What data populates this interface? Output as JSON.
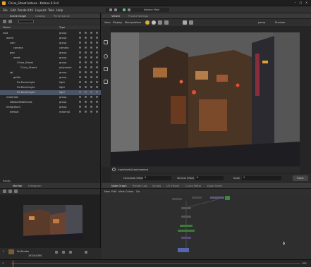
{
  "window": {
    "title": "China_Street.katana - Katana 6.5v4"
  },
  "menubar": {
    "items": [
      "File",
      "Edit",
      "Render",
      "Util",
      "Layouts",
      "Tabs",
      "Help"
    ],
    "layout": "Katana Main"
  },
  "scenegraph": {
    "tabs": [
      "Scene Graph",
      "Catalog",
      "Performance"
    ],
    "columns": [
      "Name",
      "Type"
    ],
    "rows": [
      {
        "name": "root",
        "type": "group",
        "indent": 0
      },
      {
        "name": "world",
        "type": "group",
        "indent": 1
      },
      {
        "name": "cam",
        "type": "group",
        "indent": 2
      },
      {
        "name": "camera",
        "type": "camera",
        "indent": 3
      },
      {
        "name": "geo",
        "type": "group",
        "indent": 2
      },
      {
        "name": "asset",
        "type": "group",
        "indent": 3
      },
      {
        "name": "China_Street",
        "type": "group",
        "indent": 4
      },
      {
        "name": "China_Street",
        "type": "polymesh",
        "indent": 5
      },
      {
        "name": "lgt",
        "type": "group",
        "indent": 2
      },
      {
        "name": "gaffer",
        "type": "group",
        "indent": 3
      },
      {
        "name": "PxrDomeLight",
        "type": "light",
        "indent": 4
      },
      {
        "name": "PxrDirectLight",
        "type": "light",
        "indent": 4
      },
      {
        "name": "PxrDomeLight",
        "type": "light",
        "indent": 4,
        "selected": true
      },
      {
        "name": "materials",
        "type": "group",
        "indent": 1
      },
      {
        "name": "NetworkMaterials",
        "type": "group",
        "indent": 2
      },
      {
        "name": "integrators",
        "type": "group",
        "indent": 1
      },
      {
        "name": "default",
        "type": "material",
        "indent": 2
      }
    ],
    "footer": "Ready"
  },
  "viewer": {
    "tabs": [
      "Viewer",
      "Project Settings"
    ],
    "menu": [
      "View",
      "Display",
      "Manipulators"
    ],
    "camera_path": "/root/world/cam/camera",
    "fields": [
      {
        "label": "Horizontal Offset",
        "value": "0"
      },
      {
        "label": "Vertical Offset",
        "value": "0"
      },
      {
        "label": "Scale",
        "value": "1"
      }
    ],
    "reset_label": "Reset",
    "shading": "persp",
    "preview": "Preview"
  },
  "monitor": {
    "tabs": [
      "Monitor",
      "Histogram"
    ],
    "frame": "1",
    "renderer": "PxrRender",
    "resolution": "1920x1080"
  },
  "nodegraph": {
    "tabs": [
      "Node Graph",
      "Render Log",
      "Scripts",
      "UV Viewer",
      "Curve Editor",
      "Dope Sheet"
    ],
    "menu": [
      "New",
      "Edit",
      "View",
      "Colors",
      "Go"
    ],
    "nodes": [
      {
        "label": "CameraCreate",
        "color": "#4a4a4a"
      },
      {
        "label": "Merge",
        "color": "#555555"
      },
      {
        "label": "GafferThree",
        "color": "#4a4a4a"
      },
      {
        "label": "RenderSettings",
        "color": "#3b7a3b"
      },
      {
        "label": "PrmanGlobalSettings",
        "color": "#3b7a3b"
      },
      {
        "label": "Render",
        "color": "#5a4a7a"
      }
    ]
  },
  "timeline": {
    "start": "1",
    "end": "100",
    "current": "1"
  }
}
